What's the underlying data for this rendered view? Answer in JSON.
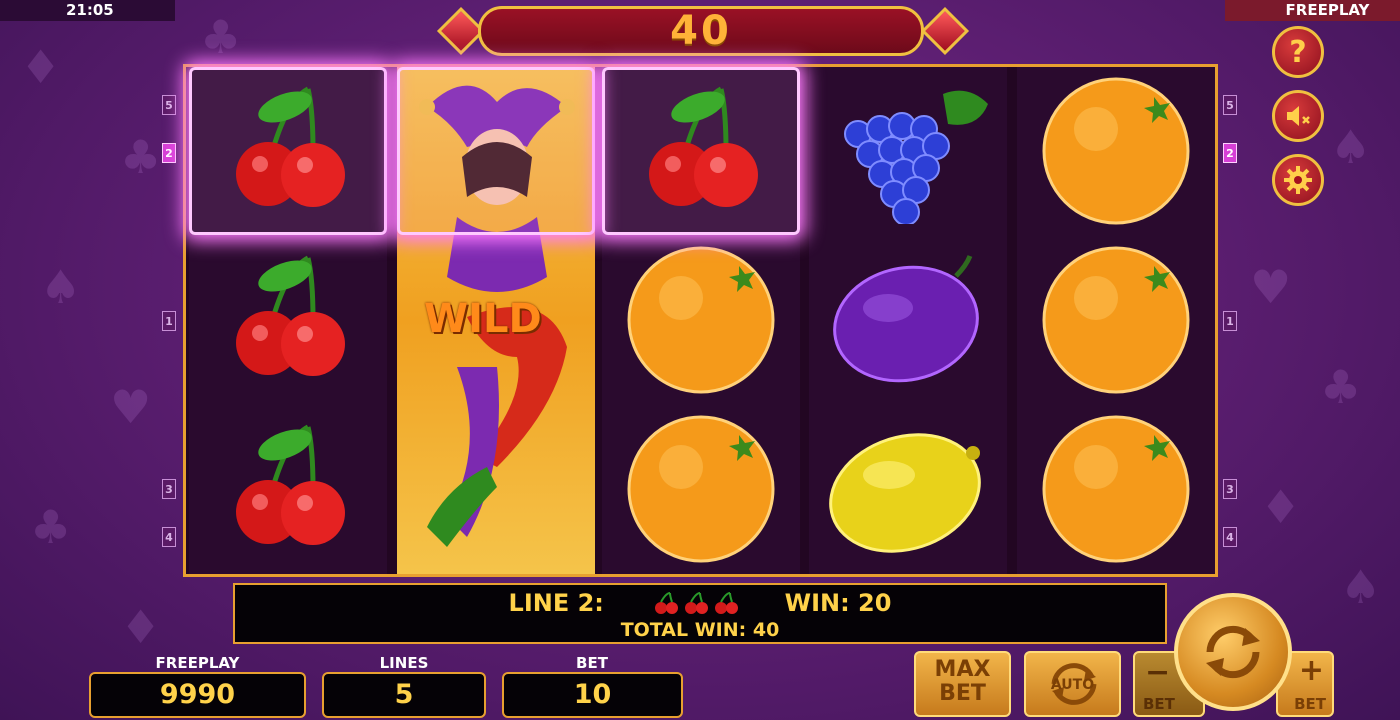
{
  "status_bar": {
    "clock": "21:05",
    "mode": "FREEPLAY"
  },
  "win_banner": {
    "value": "40"
  },
  "side_buttons": {
    "help": "?"
  },
  "reels": {
    "columns": [
      [
        "cherry",
        "cherry",
        "cherry"
      ],
      [
        "wild",
        "wild",
        "wild"
      ],
      [
        "cherry",
        "orange",
        "orange"
      ],
      [
        "grapes",
        "plum",
        "lemon"
      ],
      [
        "orange",
        "orange",
        "orange"
      ]
    ],
    "winning_cells": [
      [
        0,
        0
      ],
      [
        1,
        0
      ],
      [
        2,
        0
      ]
    ],
    "wild_label": "WILD"
  },
  "line_numbers": {
    "left": [
      "5",
      "2",
      "1",
      "3",
      "4"
    ],
    "right": [
      "5",
      "2",
      "1",
      "3",
      "4"
    ],
    "active": "2"
  },
  "message": {
    "line_label": "LINE 2:",
    "win_label": "WIN: 20",
    "total_win": "TOTAL WIN: 40"
  },
  "stats": {
    "balance_label": "FREEPLAY",
    "balance_value": "9990",
    "lines_label": "LINES",
    "lines_value": "5",
    "bet_label": "BET",
    "bet_value": "10"
  },
  "controls": {
    "max_bet_line1": "MAX",
    "max_bet_line2": "BET",
    "auto_label": "AUTO",
    "bet_minus_symbol": "−",
    "bet_minus_label": "BET",
    "bet_plus_symbol": "+",
    "bet_plus_label": "BET"
  },
  "colors": {
    "accent_gold": "#f0c040",
    "text_yellow": "#ffd24a",
    "banner_red": "#9a1125",
    "win_glow": "#ff7bff"
  }
}
